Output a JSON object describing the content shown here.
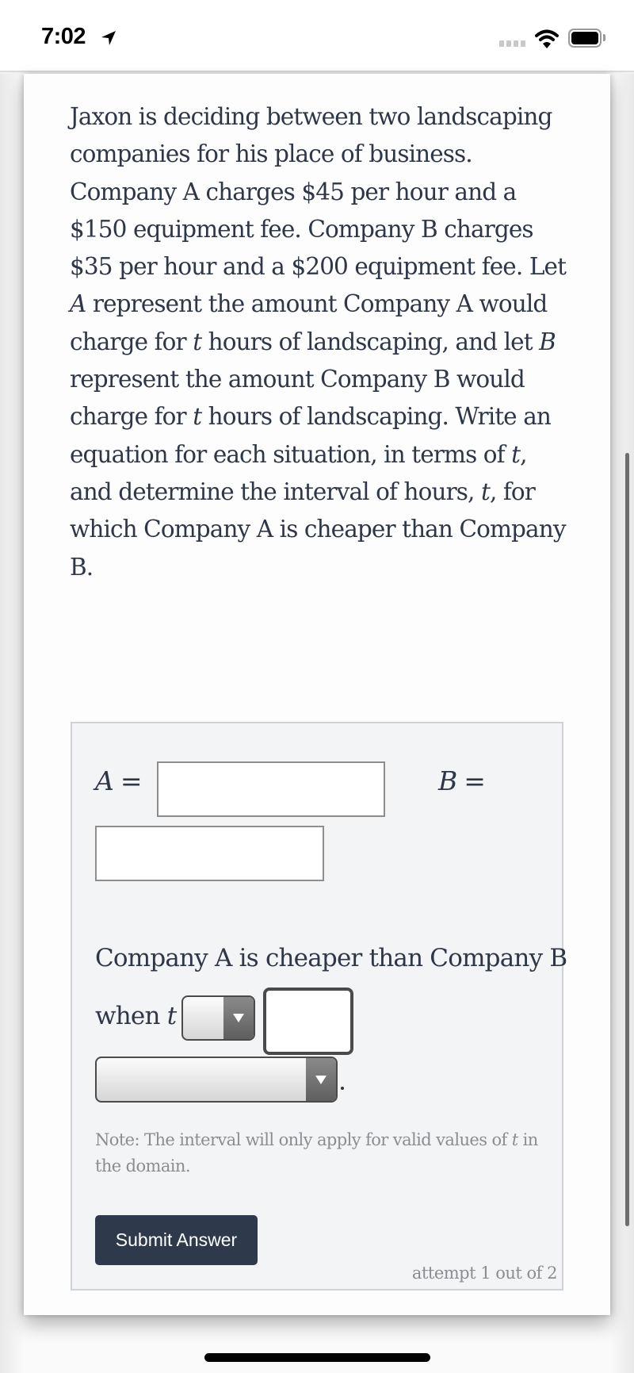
{
  "status_bar": {
    "time": "7:02",
    "icons": [
      "location-arrow-icon",
      "signal-icon",
      "wifi-icon",
      "battery-icon"
    ]
  },
  "question": {
    "segments": [
      {
        "text": "Jaxon is deciding between two landscaping companies for his place of business. Company A charges $45 per hour and a $150 equipment fee. Company B charges $35 per hour and a $200 equipment fee. Let ",
        "math": false
      },
      {
        "text": "A",
        "math": true
      },
      {
        "text": " represent the amount Company A would charge for ",
        "math": false
      },
      {
        "text": "t",
        "math": true
      },
      {
        "text": " hours of landscaping, and let ",
        "math": false
      },
      {
        "text": "B",
        "math": true
      },
      {
        "text": " represent the amount Company B would charge for ",
        "math": false
      },
      {
        "text": "t",
        "math": true
      },
      {
        "text": " hours of landscaping. Write an equation for each situation, in terms of ",
        "math": false
      },
      {
        "text": "t",
        "math": true
      },
      {
        "text": ", and determine the interval of hours, ",
        "math": false
      },
      {
        "text": "t",
        "math": true
      },
      {
        "text": ", for which Company A is cheaper than Company B.",
        "math": false
      }
    ]
  },
  "answer": {
    "eq_a": {
      "var": "A",
      "sign": "=",
      "value": ""
    },
    "eq_b": {
      "var": "B",
      "sign": "=",
      "value": ""
    },
    "sentence_line1": "Company A is cheaper than Company B",
    "sentence_when": "when",
    "sentence_var": "t",
    "comparison_select": {
      "selected": ""
    },
    "bound_value": "",
    "interval_select": {
      "selected": ""
    },
    "period": ".",
    "note_prefix": "Note: The interval will only apply for valid values of ",
    "note_var": "t",
    "note_suffix": " in the domain.",
    "submit_label": "Submit Answer",
    "attempt_text": "attempt 1 out of 2"
  },
  "colors": {
    "text": "#2d3748",
    "button_bg": "#2e3a4b",
    "muted": "#8a8d91",
    "answer_bg": "#f3f4f6"
  }
}
